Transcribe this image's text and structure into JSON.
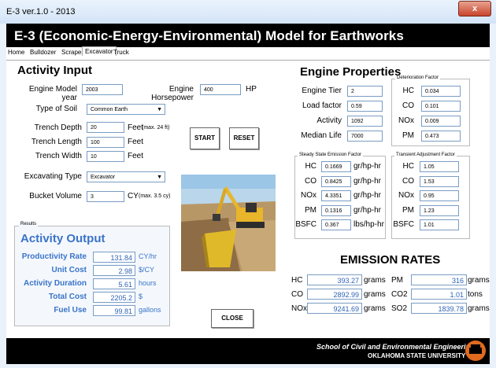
{
  "window": {
    "title": "E-3 ver.1.0 - 2013",
    "close_glyph": "x"
  },
  "banner_title": "E-3 (Economic-Energy-Environmental) Model for Earthworks",
  "tabs": [
    "Home",
    "Bulldozer",
    "Scraper",
    "Excavator",
    "Truck"
  ],
  "activity_input": {
    "heading": "Activity Input",
    "engine_model_year_label": "Engine Model year",
    "engine_model_year": "2003",
    "engine_hp_label": "Engine Horsepower",
    "engine_hp": "400",
    "hp_unit": "HP",
    "soil_label": "Type of Soil",
    "soil": "Common Earth",
    "depth_label": "Trench Depth",
    "depth": "20",
    "depth_unit": "Feet",
    "depth_note": "(max. 24 ft)",
    "length_label": "Trench Length",
    "length": "100",
    "length_unit": "Feet",
    "width_label": "Trench Width",
    "width": "10",
    "width_unit": "Feet",
    "exc_type_label": "Excavating Type",
    "exc_type": "Excavator",
    "bucket_label": "Bucket Volume",
    "bucket": "3",
    "bucket_unit": "CY",
    "bucket_note": "(max. 3.5 cy)",
    "start_button": "START",
    "reset_button": "RESET"
  },
  "results": {
    "group_label": "Results",
    "heading": "Activity Output",
    "rows": [
      {
        "label": "Productivity Rate",
        "value": "131.84",
        "unit": "CY/hr"
      },
      {
        "label": "Unit Cost",
        "value": "2.98",
        "unit": "$/CY"
      },
      {
        "label": "Activity Duration",
        "value": "5.61",
        "unit": "hours"
      },
      {
        "label": "Total Cost",
        "value": "2205.2",
        "unit": "$"
      },
      {
        "label": "Fuel Use",
        "value": "99.81",
        "unit": "gallons"
      }
    ],
    "close_button": "CLOSE"
  },
  "engine_properties": {
    "heading": "Engine Properties",
    "rows": [
      {
        "label": "Engine Tier",
        "value": "2"
      },
      {
        "label": "Load factor",
        "value": "0.59"
      },
      {
        "label": "Activity",
        "value": "1092"
      },
      {
        "label": "Median Life",
        "value": "7000"
      }
    ],
    "deterioration": {
      "label": "Deterioration Factor",
      "rows": [
        {
          "label": "HC",
          "value": "0.034"
        },
        {
          "label": "CO",
          "value": "0.101"
        },
        {
          "label": "NOx",
          "value": "0.009"
        },
        {
          "label": "PM",
          "value": "0.473"
        }
      ]
    },
    "steady_state": {
      "label": "Steady State Emission Factor",
      "rows": [
        {
          "label": "HC",
          "value": "0.1669",
          "unit": "gr/hp-hr"
        },
        {
          "label": "CO",
          "value": "0.8425",
          "unit": "gr/hp-hr"
        },
        {
          "label": "NOx",
          "value": "4.3351",
          "unit": "gr/hp-hr"
        },
        {
          "label": "PM",
          "value": "0.1316",
          "unit": "gr/hp-hr"
        },
        {
          "label": "BSFC",
          "value": "0.367",
          "unit": "lbs/hp-hr"
        }
      ]
    },
    "transient": {
      "label": "Transient Adjustment Factor",
      "rows": [
        {
          "label": "HC",
          "value": "1.05"
        },
        {
          "label": "CO",
          "value": "1.53"
        },
        {
          "label": "NOx",
          "value": "0.95"
        },
        {
          "label": "PM",
          "value": "1.23"
        },
        {
          "label": "BSFC",
          "value": "1.01"
        }
      ]
    }
  },
  "emission_rates": {
    "heading": "EMISSION RATES",
    "left": [
      {
        "label": "HC",
        "value": "393.27",
        "unit": "grams"
      },
      {
        "label": "CO",
        "value": "2892.99",
        "unit": "grams"
      },
      {
        "label": "NOx",
        "value": "9241.69",
        "unit": "grams"
      }
    ],
    "right": [
      {
        "label": "PM",
        "value": "316",
        "unit": "grams"
      },
      {
        "label": "CO2",
        "value": "1.01",
        "unit": "tons"
      },
      {
        "label": "SO2",
        "value": "1839.78",
        "unit": "grams"
      }
    ]
  },
  "footer": {
    "line1": "School of Civil and Environmental Engineering",
    "line2": "OKLAHOMA STATE UNIVERSITY"
  },
  "colors": {
    "banner": "#000000",
    "accent_blue": "#3a73c7",
    "output_text": "#2f63b8",
    "logo_orange": "#e06b1f"
  }
}
